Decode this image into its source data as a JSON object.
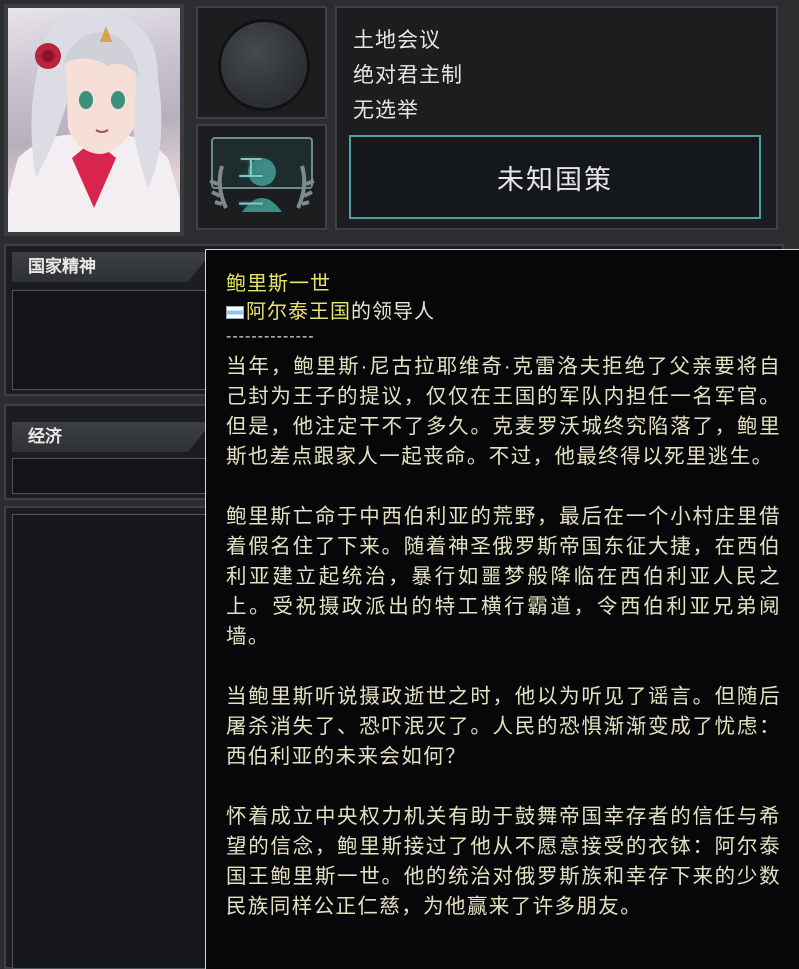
{
  "ideology": {
    "line1": "土地会议",
    "line2": "绝对君主制",
    "line3": "无选举",
    "policy_button": "未知国策"
  },
  "rank_badge": {
    "text": "工一"
  },
  "sections": {
    "national_spirit": "国家精神",
    "economy": "经济"
  },
  "tooltip": {
    "leader_name": "鲍里斯一世",
    "country_name": "阿尔泰王国",
    "title_suffix": "的领导人",
    "separator": "--------------",
    "paragraphs": [
      "当年，鲍里斯·尼古拉耶维奇·克雷洛夫拒绝了父亲要将自己封为王子的提议，仅仅在王国的军队内担任一名军官。但是，他注定干不了多久。克麦罗沃城终究陷落了，鲍里斯也差点跟家人一起丧命。不过，他最终得以死里逃生。",
      "鲍里斯亡命于中西伯利亚的荒野，最后在一个小村庄里借着假名住了下来。随着神圣俄罗斯帝国东征大捷，在西伯利亚建立起统治，暴行如噩梦般降临在西伯利亚人民之上。受祝摄政派出的特工横行霸道，令西伯利亚兄弟阋墙。",
      "当鲍里斯听说摄政逝世之时，他以为听见了谣言。但随后屠杀消失了、恐吓泯灭了。人民的恐惧渐渐变成了忧虑：西伯利亚的未来会如何？",
      "怀着成立中央权力机关有助于鼓舞帝国幸存者的信任与希望的信念，鲍里斯接过了他从不愿意接受的衣钵：阿尔泰国王鲍里斯一世。他的统治对俄罗斯族和幸存下来的少数民族同样公正仁慈，为他赢来了许多朋友。"
    ]
  },
  "colors": {
    "highlight_yellow": "#e9e36a",
    "body_text": "#e6e0c2",
    "policy_border": "#4f9fa7",
    "flag_blue": "#8fc8ef"
  }
}
